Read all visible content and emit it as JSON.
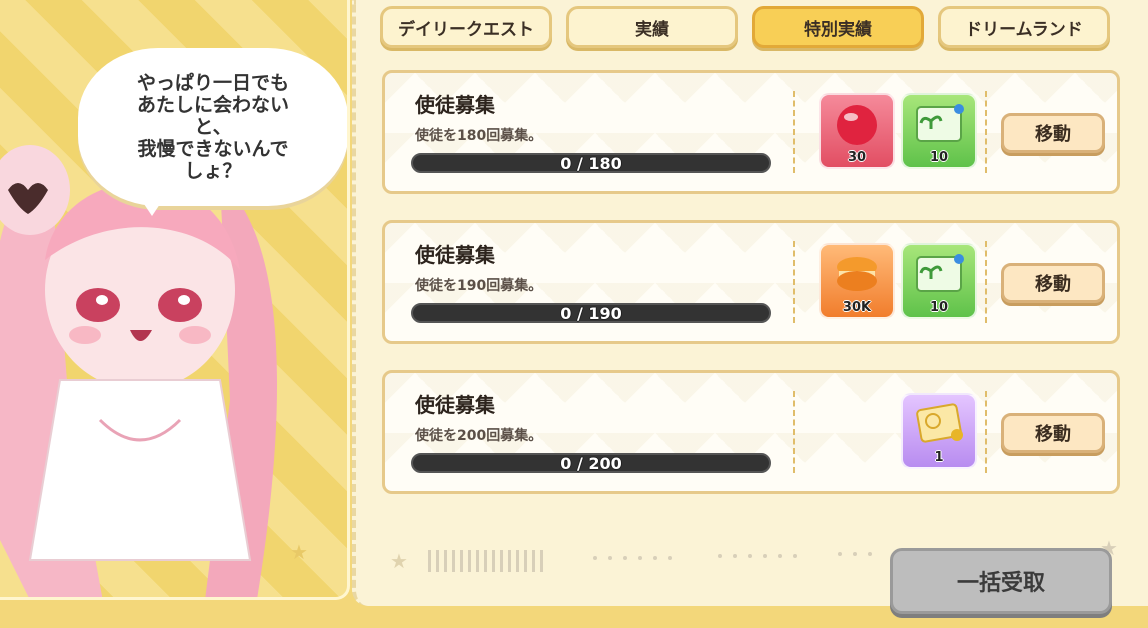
{
  "speech_bubble": {
    "text": "やっぱり一日でも\nあたしに会わない\nと、\n我慢できないんで\nしょ？"
  },
  "tabs": [
    {
      "label": "デイリークエスト",
      "active": false
    },
    {
      "label": "実績",
      "active": false
    },
    {
      "label": "特別実績",
      "active": true
    },
    {
      "label": "ドリームランド",
      "active": false
    }
  ],
  "quests": [
    {
      "title": "使徒募集",
      "description": "使徒を180回募集。",
      "progress": {
        "current": 0,
        "total": 180,
        "text": "0 / 180"
      },
      "rewards": [
        {
          "icon": "red-orb-icon",
          "quantity": "30"
        },
        {
          "icon": "sprout-ticket-icon",
          "quantity": "10"
        }
      ],
      "button_label": "移動"
    },
    {
      "title": "使徒募集",
      "description": "使徒を190回募集。",
      "progress": {
        "current": 0,
        "total": 190,
        "text": "0 / 190"
      },
      "rewards": [
        {
          "icon": "macaron-icon",
          "quantity": "30K"
        },
        {
          "icon": "sprout-ticket-icon",
          "quantity": "10"
        }
      ],
      "button_label": "移動"
    },
    {
      "title": "使徒募集",
      "description": "使徒を200回募集。",
      "progress": {
        "current": 0,
        "total": 200,
        "text": "0 / 200"
      },
      "rewards": [
        {
          "icon": "gold-ticket-icon",
          "quantity": "1"
        }
      ],
      "button_label": "移動"
    }
  ],
  "claim_all": {
    "label": "一括受取",
    "enabled": false
  },
  "colors": {
    "active_tab": "#f8cf56",
    "tab": "#fdf3cf",
    "progress_track": "#333333",
    "claim_disabled": "#bdbdbd"
  }
}
